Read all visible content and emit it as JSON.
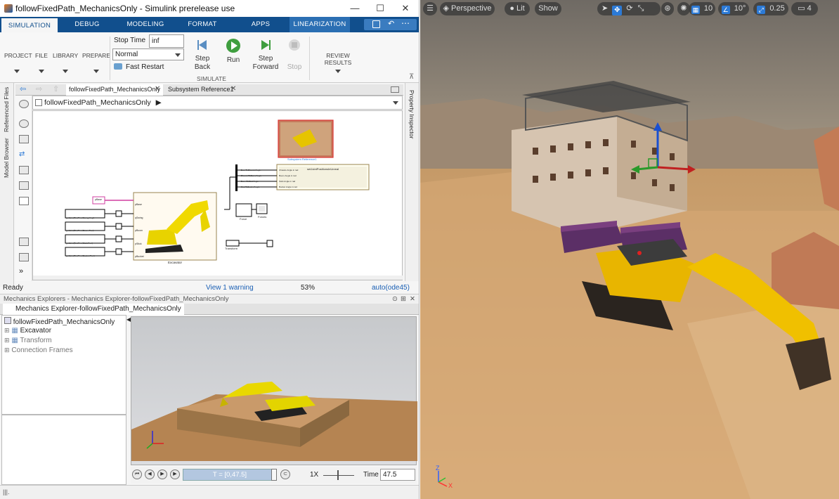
{
  "window": {
    "title": "followFixedPath_MechanicsOnly - Simulink prerelease use",
    "minimize_glyph": "—",
    "maximize_glyph": "☐",
    "close_glyph": "✕"
  },
  "ribbon": {
    "tabs": [
      "SIMULATION",
      "DEBUG",
      "MODELING",
      "FORMAT",
      "APPS",
      "LINEARIZATION"
    ],
    "groups": {
      "project": "PROJECT",
      "file": "FILE",
      "library": "LIBRARY",
      "prepare": "PREPARE",
      "simulate": "SIMULATE",
      "review": "REVIEW RESULTS"
    },
    "stop_time_label": "Stop Time",
    "stop_time_value": "inf",
    "mode_value": "Normal",
    "fast_restart": "Fast Restart",
    "step_back": "Step",
    "step_back_2": "Back",
    "run": "Run",
    "step_forward": "Step",
    "step_forward_2": "Forward",
    "stop": "Stop"
  },
  "editor": {
    "tabs": [
      "followFixedPath_MechanicsOnly",
      "Subsystem Reference1"
    ],
    "breadcrumb": "followFixedPath_MechanicsOnly",
    "side_panels": [
      "Referenced Files",
      "Model Browser"
    ],
    "right_panel": "Property Inspector"
  },
  "diagram": {
    "excavator_label": "Excavator",
    "subsystem_ref_label": "Subsystem Reference1",
    "lookup_blocks": [
      "getJoint(TestP.ex,'Swing.Ang')",
      "getJoint(TestP.ex,'Boom.Pos')",
      "getJoint(TestP.ex,'Stick.Pos')",
      "getJoint(TestP.ex,'Bucket.Pos')"
    ],
    "excavator_ports": [
      "pBase",
      "qSwing",
      "pBoom",
      "pStick",
      "pBucket"
    ],
    "pbase_block": "pBase",
    "bus_signals": [
      "<BaseToChassisAngle>",
      "<ChassisToBoomAngle>",
      "<BoomToStickAngle>",
      "<StickToBucketAngle>"
    ],
    "display_inputs": [
      "Chassis Angle in rad",
      "Boom Angle in rad",
      "Stick Angle in rad",
      "Bucket Angle in rad"
    ],
    "display_title": "setJointPositionsInUnreal",
    "force_label": "Force",
    "forces_label": "Forces",
    "transform_label": "Transform"
  },
  "status": {
    "ready": "Ready",
    "warning": "View 1 warning",
    "zoom": "53%",
    "solver": "auto(ode45)"
  },
  "mechanics": {
    "header": "Mechanics Explorers - Mechanics Explorer-followFixedPath_MechanicsOnly",
    "tab": "Mechanics Explorer-followFixedPath_MechanicsOnly",
    "tree": [
      "followFixedPath_MechanicsOnly",
      "Excavator",
      "Transform",
      "Connection Frames"
    ],
    "time_slider": "T = [0,47.5]",
    "speed": "1X",
    "time_label": "Time",
    "time_value": "47.5"
  },
  "viewport": {
    "perspective": "Perspective",
    "lit": "Lit",
    "show": "Show",
    "grid_value": "10",
    "angle_value": "10°",
    "scale_value": "0.25",
    "camera_speed": "4",
    "axis_x": "X",
    "axis_z": "Z",
    "axis_y": "Y"
  }
}
